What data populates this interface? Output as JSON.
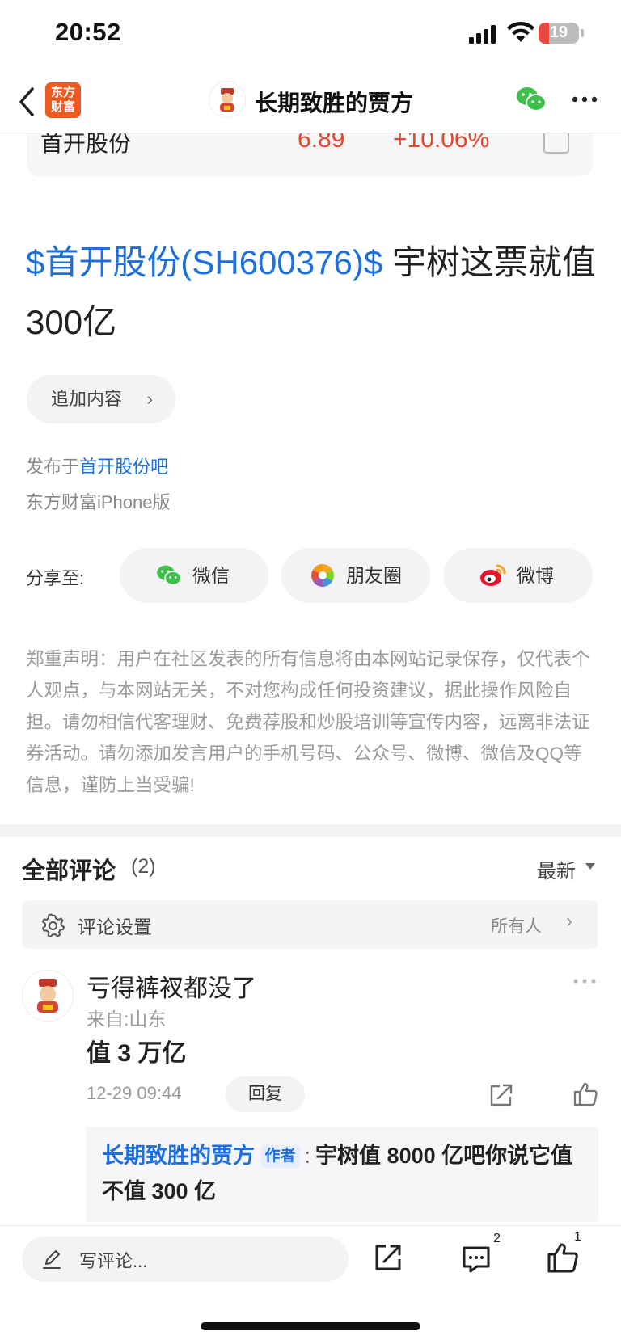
{
  "status_bar": {
    "time": "20:52",
    "battery": "19"
  },
  "nav": {
    "app_logo": "东方\n财富",
    "title": "长期致胜的贾方",
    "icons": [
      "chevron-left-icon",
      "wechat-icon",
      "more-icon"
    ]
  },
  "stock": {
    "name": "首开股份",
    "price": "6.89",
    "change": "+10.06%"
  },
  "post": {
    "stock_link": "$首开股份(SH600376)$",
    "text": " 宇树这票就值300亿"
  },
  "add_content_label": "追加内容",
  "published": {
    "prefix": "发布于",
    "forum": "首开股份吧",
    "client": "东方财富iPhone版"
  },
  "share": {
    "label": "分享至:",
    "targets": [
      "微信",
      "朋友圈",
      "微博"
    ]
  },
  "disclaimer": "郑重声明：用户在社区发表的所有信息将由本网站记录保存，仅代表个人观点，与本网站无关，不对您构成任何投资建议，据此操作风险自担。请勿相信代客理财、免费荐股和炒股培训等宣传内容，远离非法证券活动。请勿添加发言用户的手机号码、公众号、微博、微信及QQ等信息，谨防上当受骗!",
  "comments": {
    "title": "全部评论",
    "count": "(2)",
    "sort": "最新",
    "setting_label": "评论设置",
    "setting_value": "所有人",
    "items": [
      {
        "user": "亏得裤衩都没了",
        "location": "来自:山东",
        "text": "值 3 万亿",
        "time": "12-29 09:44",
        "reply_label": "回复",
        "reply": {
          "user": "长期致胜的贾方",
          "badge": "作者",
          "colon": ":",
          "text": "宇树值 8000 亿吧你说它值不值 300 亿"
        }
      }
    ]
  },
  "bottom": {
    "write_placeholder": "写评论...",
    "comment_count": "2",
    "like_count": "1"
  },
  "colors": {
    "accent_blue": "#1c6fe0",
    "up_red": "#e8452c",
    "brand_orange": "#ef5a1e"
  }
}
